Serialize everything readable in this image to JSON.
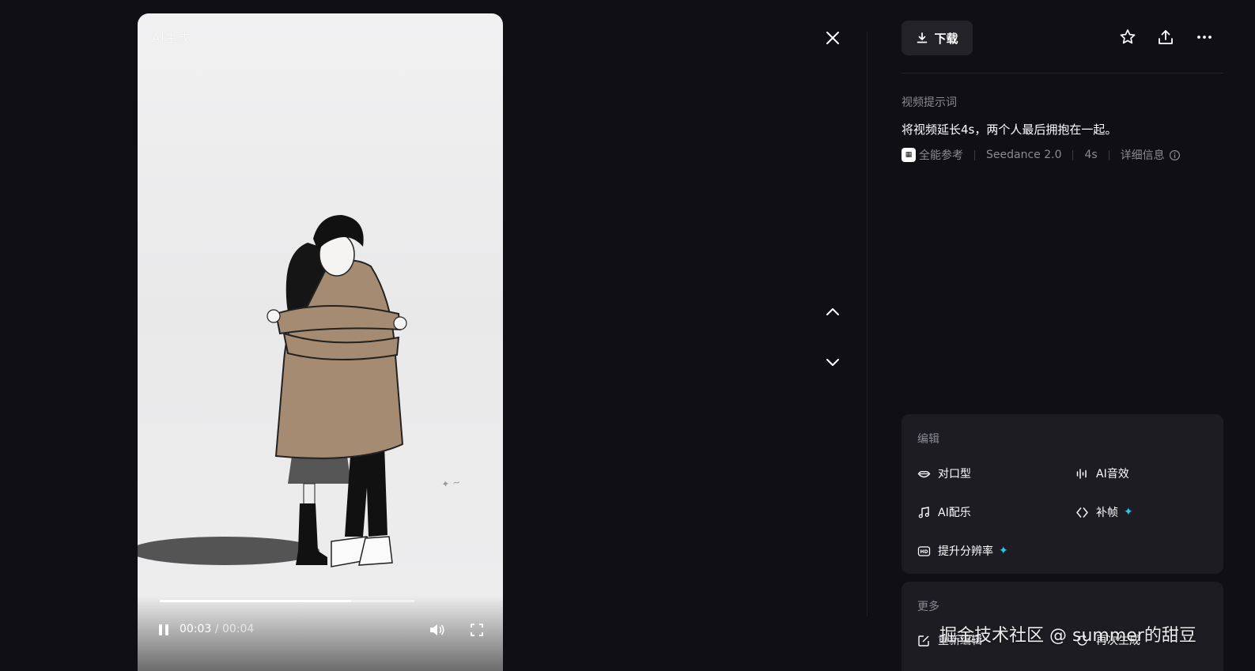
{
  "video": {
    "ai_tag": "AI生成",
    "current_time": "00:03",
    "separator": "/",
    "duration": "00:04",
    "progress_fraction": 0.75,
    "playing": true
  },
  "nav": {
    "close_icon": "close-icon",
    "prev_icon": "chevron-up-icon",
    "next_icon": "chevron-down-icon"
  },
  "toolbar": {
    "download_label": "下载",
    "icons": [
      "star-icon",
      "share-icon",
      "more-icon"
    ]
  },
  "prompt": {
    "label": "视频提示词",
    "text": "将视频延长4s，两个人最后拥抱在一起。"
  },
  "meta": {
    "mode_label": "全能参考",
    "model": "Seedance 2.0",
    "length": "4s",
    "details_label": "详细信息"
  },
  "edit_card": {
    "title": "编辑",
    "tools": {
      "lip_sync": "对口型",
      "ai_sound": "AI音效",
      "ai_music": "AI配乐",
      "frame_fill": "补帧",
      "upscale": "提升分辨率"
    }
  },
  "more_card": {
    "title": "更多",
    "tools": {
      "re_edit": "重新编辑",
      "regenerate": "再次生成"
    }
  },
  "watermark": "掘金技术社区 @ summer的甜豆",
  "colors": {
    "background": "#101014",
    "card": "#1c1c22",
    "accent_spark": "#2cc9e8"
  }
}
